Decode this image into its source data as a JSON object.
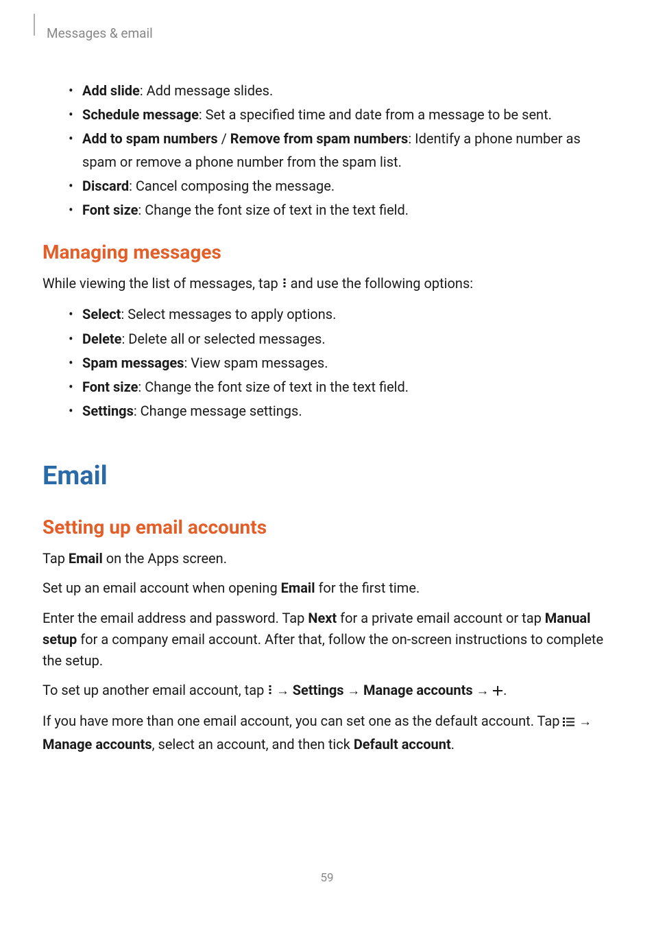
{
  "header": {
    "breadcrumb": "Messages & email"
  },
  "section1": {
    "items": [
      {
        "bold": "Add slide",
        "rest": ": Add message slides."
      },
      {
        "bold": "Schedule message",
        "rest": ": Set a specified time and date from a message to be sent."
      },
      {
        "bold": "Add to spam numbers",
        "slash": " / ",
        "bold2": "Remove from spam numbers",
        "rest": ": Identify a phone number as spam or remove a phone number from the spam list."
      },
      {
        "bold": "Discard",
        "rest": ": Cancel composing the message."
      },
      {
        "bold": "Font size",
        "rest": ": Change the font size of text in the text field."
      }
    ]
  },
  "section2": {
    "heading": "Managing messages",
    "intro_before": "While viewing the list of messages, tap ",
    "intro_after": " and use the following options:",
    "items": [
      {
        "bold": "Select",
        "rest": ": Select messages to apply options."
      },
      {
        "bold": "Delete",
        "rest": ": Delete all or selected messages."
      },
      {
        "bold": "Spam messages",
        "rest": ": View spam messages."
      },
      {
        "bold": "Font size",
        "rest": ": Change the font size of text in the text field."
      },
      {
        "bold": "Settings",
        "rest": ": Change message settings."
      }
    ]
  },
  "section3": {
    "heading": "Email",
    "subheading": "Setting up email accounts",
    "p1_before": "Tap ",
    "p1_bold": "Email",
    "p1_after": " on the Apps screen.",
    "p2_before": "Set up an email account when opening ",
    "p2_bold": "Email",
    "p2_after": " for the first time.",
    "p3_a": "Enter the email address and password. Tap ",
    "p3_bold1": "Next",
    "p3_b": " for a private email account or tap ",
    "p3_bold2": "Manual setup",
    "p3_c": " for a company email account. After that, follow the on-screen instructions to complete the setup.",
    "p4_a": "To set up another email account, tap ",
    "p4_arrow": " → ",
    "p4_bold1": "Settings",
    "p4_bold2": "Manage accounts",
    "p4_period": ".",
    "p5_a": "If you have more than one email account, you can set one as the default account. Tap ",
    "p5_bold1": "Manage accounts",
    "p5_b": ", select an account, and then tick ",
    "p5_bold2": "Default account",
    "p5_period": "."
  },
  "page_number": "59"
}
